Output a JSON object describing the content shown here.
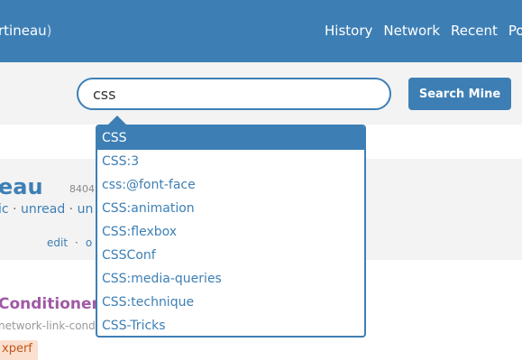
{
  "header": {
    "user_label": "rtineau",
    "user_paren": ")",
    "nav": [
      "History",
      "Network",
      "Recent",
      "Pop"
    ]
  },
  "search": {
    "value": "css",
    "button_label": "Search Mine"
  },
  "autocomplete": {
    "selected_index": 0,
    "items": [
      "CSS",
      "CSS:3",
      "css:@font-face",
      "CSS:animation",
      "CSS:flexbox",
      "CSSConf",
      "CSS:media-queries",
      "CSS:technique",
      "CSS-Tricks"
    ]
  },
  "profile": {
    "name": "eau",
    "count": "8404",
    "filters": [
      "ic",
      "unread",
      "un"
    ],
    "filter_separator": " · ",
    "edit_label": "edit",
    "other_label": "o"
  },
  "bookmark": {
    "title": "Conditioner -",
    "url": "network-link-cond",
    "tag": "xperf"
  },
  "colors": {
    "brand_blue": "#3d7fb5",
    "bookmark_purple": "#a05aa5",
    "tag_bg": "#fbe0d0"
  }
}
